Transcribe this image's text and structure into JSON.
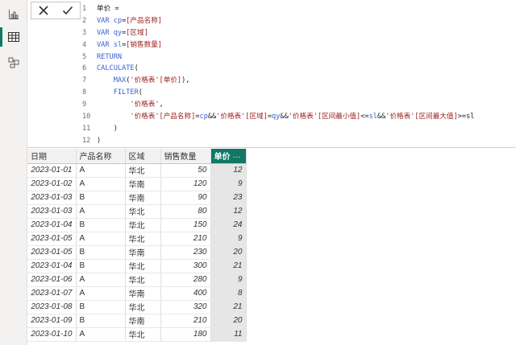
{
  "sidebar": {
    "items": [
      {
        "name": "report-view",
        "icon": "bar-chart-icon"
      },
      {
        "name": "table-view",
        "icon": "table-grid-icon",
        "active": true
      },
      {
        "name": "model-view",
        "icon": "model-diagram-icon"
      }
    ]
  },
  "formula": {
    "cancel_icon": "close-icon",
    "commit_icon": "check-icon",
    "lines": [
      {
        "n": "1",
        "tokens": [
          {
            "t": "单价 =",
            "c": "pl"
          }
        ]
      },
      {
        "n": "2",
        "tokens": [
          {
            "t": "VAR ",
            "c": "kw"
          },
          {
            "t": "cp",
            "c": "kw"
          },
          {
            "t": "=",
            "c": "op"
          },
          {
            "t": "[产品名称]",
            "c": "st"
          }
        ]
      },
      {
        "n": "3",
        "tokens": [
          {
            "t": "VAR ",
            "c": "kw"
          },
          {
            "t": "qy",
            "c": "kw"
          },
          {
            "t": "=",
            "c": "op"
          },
          {
            "t": "[区域]",
            "c": "st"
          }
        ]
      },
      {
        "n": "4",
        "tokens": [
          {
            "t": "VAR ",
            "c": "kw"
          },
          {
            "t": "sl",
            "c": "kw"
          },
          {
            "t": "=",
            "c": "op"
          },
          {
            "t": "[销售数量]",
            "c": "st"
          }
        ]
      },
      {
        "n": "5",
        "tokens": [
          {
            "t": "RETURN",
            "c": "kw"
          }
        ]
      },
      {
        "n": "6",
        "tokens": [
          {
            "t": "CALCULATE",
            "c": "fn"
          },
          {
            "t": "(",
            "c": "op"
          }
        ]
      },
      {
        "n": "7",
        "tokens": [
          {
            "t": "    ",
            "c": "pl"
          },
          {
            "t": "MAX",
            "c": "fn"
          },
          {
            "t": "(",
            "c": "op"
          },
          {
            "t": "'价格表'[单价]",
            "c": "st"
          },
          {
            "t": "),",
            "c": "op"
          }
        ]
      },
      {
        "n": "8",
        "tokens": [
          {
            "t": "    ",
            "c": "pl"
          },
          {
            "t": "FILTER",
            "c": "fn"
          },
          {
            "t": "(",
            "c": "op"
          }
        ]
      },
      {
        "n": "9",
        "tokens": [
          {
            "t": "        ",
            "c": "pl"
          },
          {
            "t": "'价格表'",
            "c": "st"
          },
          {
            "t": ",",
            "c": "op"
          }
        ]
      },
      {
        "n": "10",
        "tokens": [
          {
            "t": "        ",
            "c": "pl"
          },
          {
            "t": "'价格表'[产品名称]",
            "c": "st"
          },
          {
            "t": "=",
            "c": "op"
          },
          {
            "t": "cp",
            "c": "kw"
          },
          {
            "t": "&&",
            "c": "op"
          },
          {
            "t": "'价格表'[区域]",
            "c": "st"
          },
          {
            "t": "=",
            "c": "op"
          },
          {
            "t": "qy",
            "c": "kw"
          },
          {
            "t": "&&",
            "c": "op"
          },
          {
            "t": "'价格表'[区间最小值]",
            "c": "st"
          },
          {
            "t": "<=",
            "c": "op"
          },
          {
            "t": "sl",
            "c": "kw"
          },
          {
            "t": "&&",
            "c": "op"
          },
          {
            "t": "'价格表'[区间最大值]",
            "c": "st"
          },
          {
            "t": ">=sl",
            "c": "op"
          }
        ]
      },
      {
        "n": "11",
        "tokens": [
          {
            "t": "    ",
            "c": "pl"
          },
          {
            "t": ")",
            "c": "op"
          }
        ]
      },
      {
        "n": "12",
        "tokens": [
          {
            "t": ")",
            "c": "op"
          }
        ]
      }
    ]
  },
  "table": {
    "headers": [
      "日期",
      "产品名称",
      "区域",
      "销售数量",
      "单价"
    ],
    "selected_header_menu": "···",
    "rows": [
      [
        "2023-01-01",
        "A",
        "华北",
        "50",
        "12"
      ],
      [
        "2023-01-02",
        "A",
        "华南",
        "120",
        "9"
      ],
      [
        "2023-01-03",
        "B",
        "华南",
        "90",
        "23"
      ],
      [
        "2023-01-03",
        "A",
        "华北",
        "80",
        "12"
      ],
      [
        "2023-01-04",
        "B",
        "华北",
        "150",
        "24"
      ],
      [
        "2023-01-05",
        "A",
        "华北",
        "210",
        "9"
      ],
      [
        "2023-01-05",
        "B",
        "华南",
        "230",
        "20"
      ],
      [
        "2023-01-04",
        "B",
        "华北",
        "300",
        "21"
      ],
      [
        "2023-01-06",
        "A",
        "华北",
        "280",
        "9"
      ],
      [
        "2023-01-07",
        "A",
        "华南",
        "400",
        "8"
      ],
      [
        "2023-01-08",
        "B",
        "华北",
        "320",
        "21"
      ],
      [
        "2023-01-09",
        "B",
        "华南",
        "210",
        "20"
      ],
      [
        "2023-01-10",
        "A",
        "华北",
        "180",
        "11"
      ]
    ]
  },
  "colors": {
    "accent": "#117865",
    "keyword": "#3a5fd6",
    "string": "#9b1c1c"
  }
}
